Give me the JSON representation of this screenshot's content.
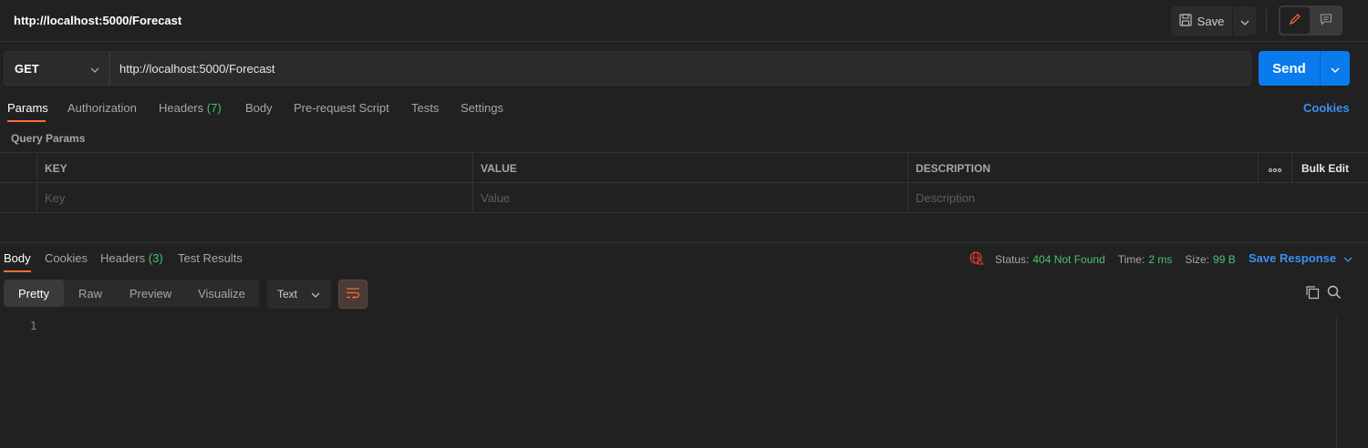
{
  "request": {
    "title": "http://localhost:5000/Forecast",
    "method": "GET",
    "url": "http://localhost:5000/Forecast",
    "send_label": "Send",
    "save_label": "Save"
  },
  "request_tabs": [
    {
      "label": "Params",
      "active": true
    },
    {
      "label": "Authorization"
    },
    {
      "label": "Headers",
      "count": "(7)"
    },
    {
      "label": "Body"
    },
    {
      "label": "Pre-request Script"
    },
    {
      "label": "Tests"
    },
    {
      "label": "Settings"
    }
  ],
  "cookies_link": "Cookies",
  "query_params": {
    "section_label": "Query Params",
    "columns": [
      "KEY",
      "VALUE",
      "DESCRIPTION"
    ],
    "placeholders": [
      "Key",
      "Value",
      "Description"
    ],
    "bulk_edit": "Bulk Edit",
    "more_icon": "ooo"
  },
  "response": {
    "tabs": [
      {
        "label": "Body",
        "active": true
      },
      {
        "label": "Cookies"
      },
      {
        "label": "Headers",
        "count": "(3)"
      },
      {
        "label": "Test Results"
      }
    ],
    "status_label": "Status:",
    "status_value": "404 Not Found",
    "time_label": "Time:",
    "time_value": "2 ms",
    "size_label": "Size:",
    "size_value": "99 B",
    "save_response": "Save Response",
    "formats": [
      "Pretty",
      "Raw",
      "Preview",
      "Visualize"
    ],
    "active_format": "Pretty",
    "type": "Text",
    "line_numbers": [
      "1"
    ]
  },
  "colors": {
    "accent": "#ff6c37",
    "primary": "#097bed",
    "link": "#3d8ff1",
    "success": "#49c46c",
    "error": "#e03c31"
  }
}
